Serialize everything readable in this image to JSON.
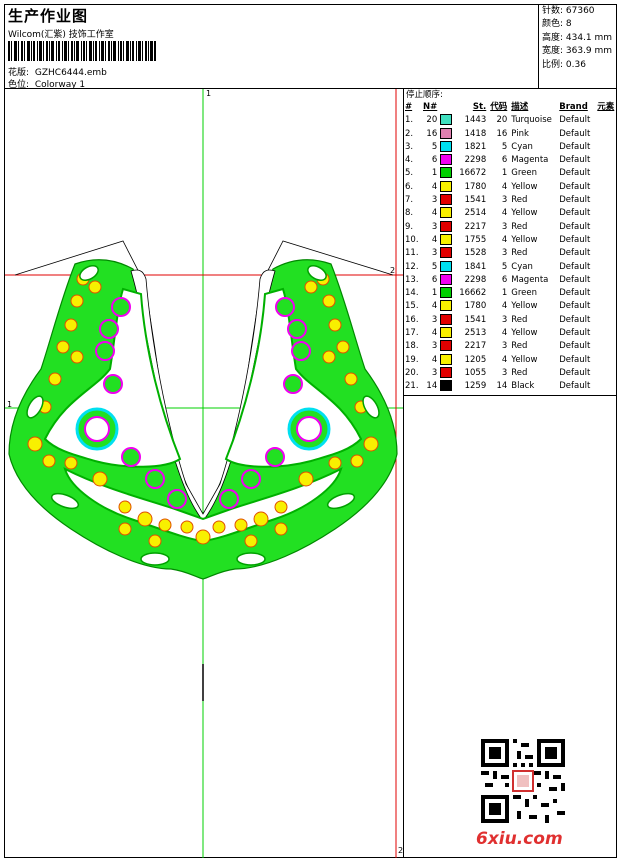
{
  "header": {
    "title": "生产作业图",
    "studio": "Wilcom(汇紫) 技饰工作室",
    "design_label": "花版:",
    "design_value": "GZHC6444.emb",
    "colorway_label": "色位:",
    "colorway_value": "Colorway 1"
  },
  "stats": {
    "stitches": "针数: 67360",
    "colors": "颜色: 8",
    "height": "高度: 434.1 mm",
    "width": "宽度: 363.9 mm",
    "scale": "比例: 0.36"
  },
  "canvas": {
    "markers": {
      "top": "1",
      "left": "1",
      "right": "2",
      "bottom": "2"
    }
  },
  "stop_sequence": {
    "title": "停止顺序:",
    "headers": {
      "idx": "#",
      "n": "N#",
      "st": "St.",
      "code": "代码",
      "desc": "描述",
      "brand": "Brand",
      "elem": "元素"
    },
    "rows": [
      {
        "idx": "1.",
        "n": "20",
        "color": "#40e0c0",
        "st": "1443",
        "code": "20",
        "desc": "Turquoise",
        "brand": "Default"
      },
      {
        "idx": "2.",
        "n": "16",
        "color": "#e080b0",
        "st": "1418",
        "code": "16",
        "desc": "Pink",
        "brand": "Default"
      },
      {
        "idx": "3.",
        "n": "5",
        "color": "#00e0f0",
        "st": "1821",
        "code": "5",
        "desc": "Cyan",
        "brand": "Default"
      },
      {
        "idx": "4.",
        "n": "6",
        "color": "#f000f0",
        "st": "2298",
        "code": "6",
        "desc": "Magenta",
        "brand": "Default"
      },
      {
        "idx": "5.",
        "n": "1",
        "color": "#00d000",
        "st": "16672",
        "code": "1",
        "desc": "Green",
        "brand": "Default"
      },
      {
        "idx": "6.",
        "n": "4",
        "color": "#f8f000",
        "st": "1780",
        "code": "4",
        "desc": "Yellow",
        "brand": "Default"
      },
      {
        "idx": "7.",
        "n": "3",
        "color": "#e00000",
        "st": "1541",
        "code": "3",
        "desc": "Red",
        "brand": "Default"
      },
      {
        "idx": "8.",
        "n": "4",
        "color": "#f8f000",
        "st": "2514",
        "code": "4",
        "desc": "Yellow",
        "brand": "Default"
      },
      {
        "idx": "9.",
        "n": "3",
        "color": "#e00000",
        "st": "2217",
        "code": "3",
        "desc": "Red",
        "brand": "Default"
      },
      {
        "idx": "10.",
        "n": "4",
        "color": "#f8f000",
        "st": "1755",
        "code": "4",
        "desc": "Yellow",
        "brand": "Default"
      },
      {
        "idx": "11.",
        "n": "3",
        "color": "#e00000",
        "st": "1528",
        "code": "3",
        "desc": "Red",
        "brand": "Default"
      },
      {
        "idx": "12.",
        "n": "5",
        "color": "#00e0f0",
        "st": "1841",
        "code": "5",
        "desc": "Cyan",
        "brand": "Default"
      },
      {
        "idx": "13.",
        "n": "6",
        "color": "#f000f0",
        "st": "2298",
        "code": "6",
        "desc": "Magenta",
        "brand": "Default"
      },
      {
        "idx": "14.",
        "n": "1",
        "color": "#00d000",
        "st": "16662",
        "code": "1",
        "desc": "Green",
        "brand": "Default"
      },
      {
        "idx": "15.",
        "n": "4",
        "color": "#f8f000",
        "st": "1780",
        "code": "4",
        "desc": "Yellow",
        "brand": "Default"
      },
      {
        "idx": "16.",
        "n": "3",
        "color": "#e00000",
        "st": "1541",
        "code": "3",
        "desc": "Red",
        "brand": "Default"
      },
      {
        "idx": "17.",
        "n": "4",
        "color": "#f8f000",
        "st": "2513",
        "code": "4",
        "desc": "Yellow",
        "brand": "Default"
      },
      {
        "idx": "18.",
        "n": "3",
        "color": "#e00000",
        "st": "2217",
        "code": "3",
        "desc": "Red",
        "brand": "Default"
      },
      {
        "idx": "19.",
        "n": "4",
        "color": "#f8f000",
        "st": "1205",
        "code": "4",
        "desc": "Yellow",
        "brand": "Default"
      },
      {
        "idx": "20.",
        "n": "3",
        "color": "#e00000",
        "st": "1055",
        "code": "3",
        "desc": "Red",
        "brand": "Default"
      },
      {
        "idx": "21.",
        "n": "14",
        "color": "#000000",
        "st": "1259",
        "code": "14",
        "desc": "Black",
        "brand": "Default"
      }
    ]
  },
  "watermark": "6xiu.com"
}
